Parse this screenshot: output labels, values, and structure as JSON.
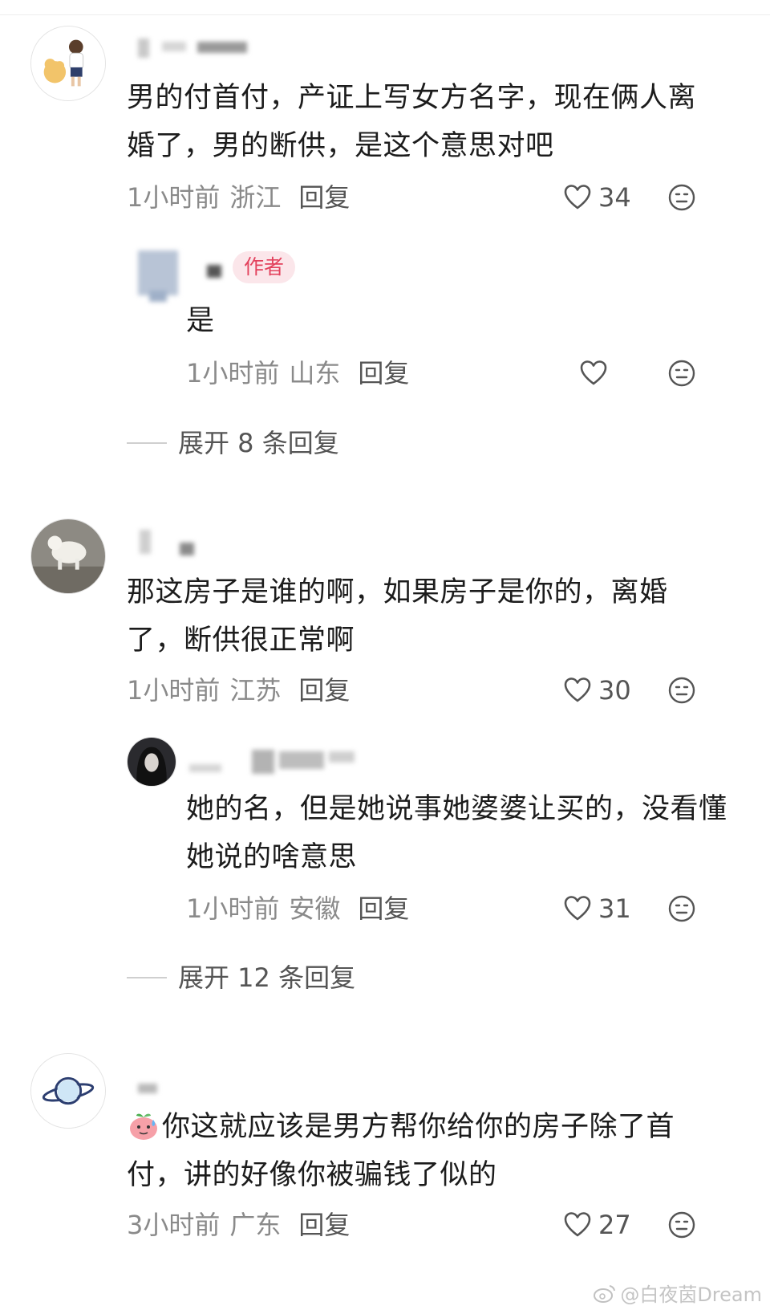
{
  "comments": [
    {
      "text": "男的付首付，产证上写女方名字，现在俩人离婚了，男的断供，是这个意思对吧",
      "time": "1小时前",
      "region": "浙江",
      "reply_label": "回复",
      "likes": "34",
      "replies": [
        {
          "badge": "作者",
          "text": "是",
          "time": "1小时前",
          "region": "山东",
          "reply_label": "回复",
          "likes": ""
        }
      ],
      "expand_label": "展开 8 条回复"
    },
    {
      "text": "那这房子是谁的啊，如果房子是你的，离婚了，断供很正常啊",
      "time": "1小时前",
      "region": "江苏",
      "reply_label": "回复",
      "likes": "30",
      "replies": [
        {
          "text": "她的名，但是她说事她婆婆让买的，没看懂她说的啥意思",
          "time": "1小时前",
          "region": "安徽",
          "reply_label": "回复",
          "likes": "31"
        }
      ],
      "expand_label": "展开 12 条回复"
    },
    {
      "text": "你这就应该是男方帮你给你的房子除了首付，讲的好像你被骗钱了似的",
      "time": "3小时前",
      "region": "广东",
      "reply_label": "回复",
      "likes": "27"
    }
  ],
  "watermark": "@白夜茵Dream",
  "colors": {
    "badge_bg": "#fbe6ea",
    "badge_text": "#e3425d",
    "meta": "#8a8a8a"
  }
}
